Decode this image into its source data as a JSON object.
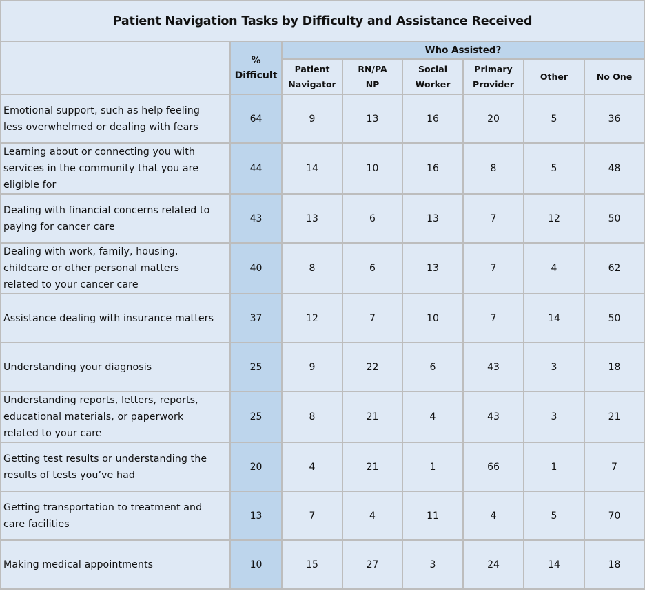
{
  "chart_data": {
    "type": "table",
    "title": "Patient Navigation Tasks by Difficulty and Assistance Received",
    "columns": {
      "task_header": "",
      "difficult_header": "% Difficult",
      "group_header": "Who Assisted?",
      "assist_headers": [
        "Patient Navigator",
        "RN/PA NP",
        "Social Worker",
        "Primary Provider",
        "Other",
        "No One"
      ]
    },
    "rows": [
      {
        "task": "Emotional support, such as help feeling less overwhelmed or dealing with fears",
        "difficult": 64,
        "assisted": [
          9,
          13,
          16,
          20,
          5,
          36
        ]
      },
      {
        "task": "Learning about or connecting you with services in the community that you are eligible for",
        "difficult": 44,
        "assisted": [
          14,
          10,
          16,
          8,
          5,
          48
        ]
      },
      {
        "task": "Dealing with financial concerns related to paying for cancer care",
        "difficult": 43,
        "assisted": [
          13,
          6,
          13,
          7,
          12,
          50
        ]
      },
      {
        "task": "Dealing with work, family, housing, childcare or other personal matters related to your cancer care",
        "difficult": 40,
        "assisted": [
          8,
          6,
          13,
          7,
          4,
          62
        ]
      },
      {
        "task": "Assistance dealing with insurance matters",
        "difficult": 37,
        "assisted": [
          12,
          7,
          10,
          7,
          14,
          50
        ]
      },
      {
        "task": "Understanding your diagnosis",
        "difficult": 25,
        "assisted": [
          9,
          22,
          6,
          43,
          3,
          18
        ]
      },
      {
        "task": "Understanding reports, letters, reports, educational materials, or paperwork related to your care",
        "difficult": 25,
        "assisted": [
          8,
          21,
          4,
          43,
          3,
          21
        ]
      },
      {
        "task": "Getting test results or understanding the results of tests you’ve had",
        "difficult": 20,
        "assisted": [
          4,
          21,
          1,
          66,
          1,
          7
        ]
      },
      {
        "task": "Getting transportation to treatment and care facilities",
        "difficult": 13,
        "assisted": [
          7,
          4,
          11,
          4,
          5,
          70
        ]
      },
      {
        "task": "Making medical appointments",
        "difficult": 10,
        "assisted": [
          15,
          27,
          3,
          24,
          14,
          18
        ]
      }
    ]
  },
  "header": {
    "difficult_lines": [
      "%",
      "Difficult"
    ],
    "assist_lines": [
      [
        "Patient",
        "Navigator"
      ],
      [
        "RN/PA",
        "NP"
      ],
      [
        "Social",
        "Worker"
      ],
      [
        "Primary",
        "Provider"
      ],
      [
        "Other"
      ],
      [
        "No One"
      ]
    ]
  },
  "row_label_lines": [
    [
      "Emotional support, such as help feeling",
      "less overwhelmed or dealing with fears"
    ],
    [
      "Learning about or connecting you with",
      "services in the community that you are",
      "eligible for"
    ],
    [
      "Dealing with financial concerns related to",
      "paying for cancer care"
    ],
    [
      "Dealing with work, family, housing,",
      "childcare or other personal matters",
      "related to your cancer care"
    ],
    [
      "Assistance dealing with insurance matters"
    ],
    [
      "Understanding your diagnosis"
    ],
    [
      "Understanding reports, letters, reports,",
      "educational materials, or paperwork",
      "related to your care"
    ],
    [
      "Getting test results or understanding the",
      "results of tests you’ve had"
    ],
    [
      "Getting transportation to treatment and",
      "care facilities"
    ],
    [
      "Making medical appointments"
    ]
  ],
  "colors": {
    "cell_bg": "#dfe9f5",
    "highlight_bg": "#bdd5ec",
    "border": "#bdbdbd"
  }
}
